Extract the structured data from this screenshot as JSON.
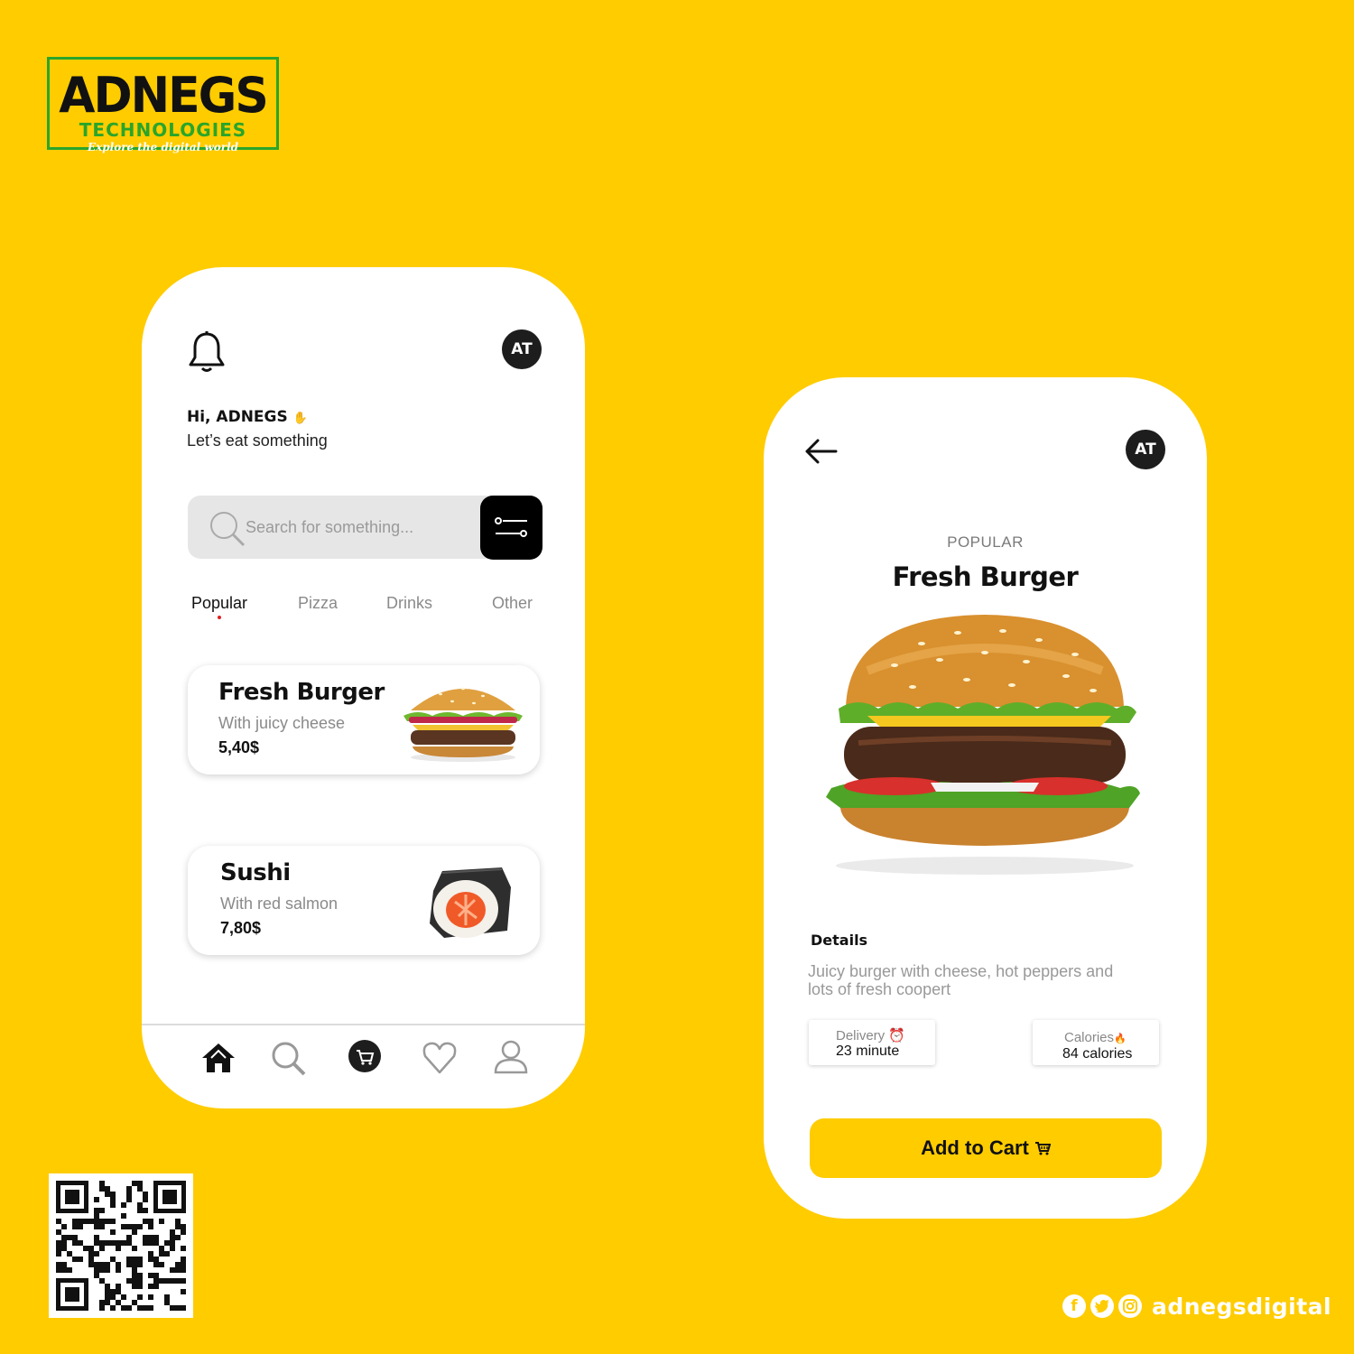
{
  "logo": {
    "main": "ADNEGS",
    "sub": "TECHNOLOGIES",
    "tagline": "Explore the digital world"
  },
  "home": {
    "avatar": "AT",
    "greeting": "Hi, ADNEGS",
    "greeting_sub": "Let’s eat something",
    "search_placeholder": "Search for something...",
    "tabs": [
      {
        "label": "Popular",
        "active": true
      },
      {
        "label": "Pizza",
        "active": false
      },
      {
        "label": "Drinks",
        "active": false
      },
      {
        "label": "Other",
        "active": false
      }
    ],
    "items": [
      {
        "title": "Fresh Burger",
        "subtitle": "With juicy cheese",
        "price": "5,40$"
      },
      {
        "title": "Sushi",
        "subtitle": "With red salmon",
        "price": "7,80$"
      }
    ],
    "nav": [
      "home-icon",
      "search-icon",
      "cart-icon",
      "heart-icon",
      "user-icon"
    ]
  },
  "detail": {
    "avatar": "AT",
    "eyebrow": "POPULAR",
    "title": "Fresh Burger",
    "details_heading": "Details",
    "description": "Juicy burger with cheese, hot peppers and lots of fresh coopert",
    "delivery_label": "Delivery",
    "delivery_value": "23 minute",
    "calories_label": "Calories",
    "calories_value": "84 calories",
    "cart_label": "Add to Cart"
  },
  "social": {
    "handle": "adnegsdigital",
    "icons": [
      "facebook-icon",
      "twitter-icon",
      "instagram-icon"
    ]
  },
  "colors": {
    "background": "#FFCC00",
    "accent_green": "#2aa52a",
    "dark": "#1d1d1d"
  }
}
